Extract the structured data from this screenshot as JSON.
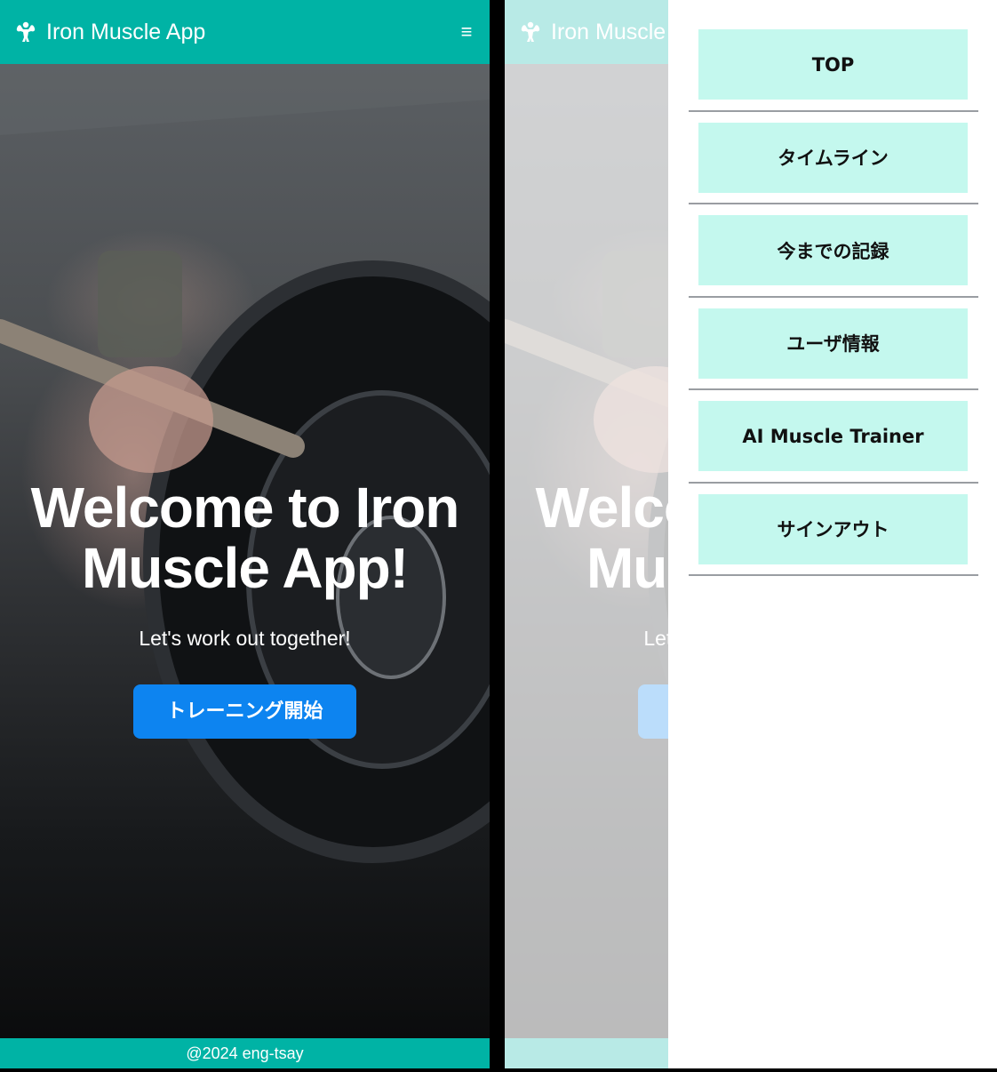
{
  "app": {
    "title": "Iron Muscle App",
    "brand_icon": "muscle-icon",
    "menu_icon": "hamburger-icon",
    "menu_glyph": "≡"
  },
  "hero": {
    "title": "Welcome to Iron Muscle App!",
    "subtitle": "Let's work out together!",
    "cta_label": "トレーニング開始"
  },
  "footer": {
    "text": "@2024 eng-tsay"
  },
  "drawer": {
    "items": [
      {
        "label": "TOP"
      },
      {
        "label": "タイムライン"
      },
      {
        "label": "今までの記録"
      },
      {
        "label": "ユーザ情報"
      },
      {
        "label": "AI Muscle Trainer"
      },
      {
        "label": "サインアウト"
      }
    ]
  },
  "colors": {
    "primary": "#00b3a5",
    "cta": "#0d84f0",
    "menu_button": "#c4f8ee",
    "divider": "#9a9da2"
  }
}
